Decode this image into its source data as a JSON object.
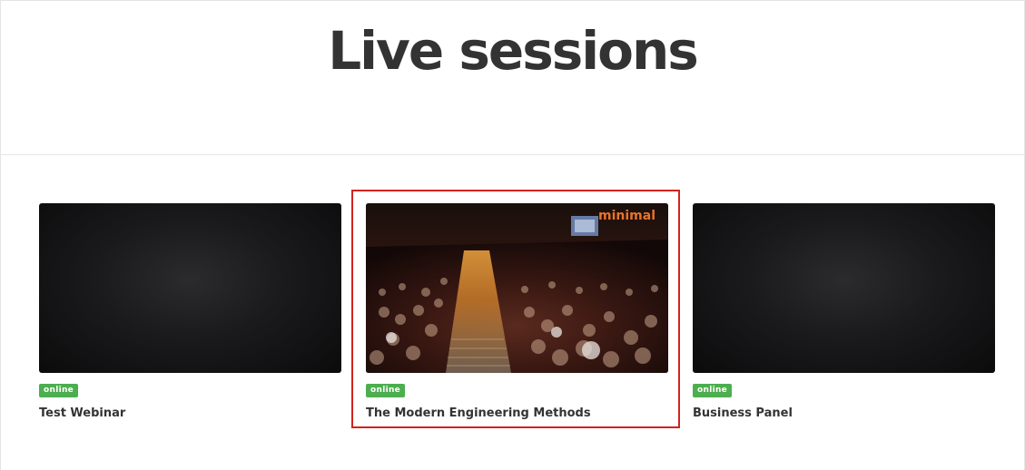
{
  "page": {
    "title": "Live sessions"
  },
  "sessions": [
    {
      "title": "Test Webinar",
      "status": "online",
      "thumbnail": "empty-dark"
    },
    {
      "title": "The Modern Engineering Methods",
      "status": "online",
      "thumbnail": "auditorium-photo",
      "logo_text": "minimal",
      "selected": true
    },
    {
      "title": "Business Panel",
      "status": "online",
      "thumbnail": "empty-dark"
    }
  ],
  "colors": {
    "badge_online": "#4cae4f",
    "selection_outline": "#d2231f",
    "title_text": "#333333"
  }
}
